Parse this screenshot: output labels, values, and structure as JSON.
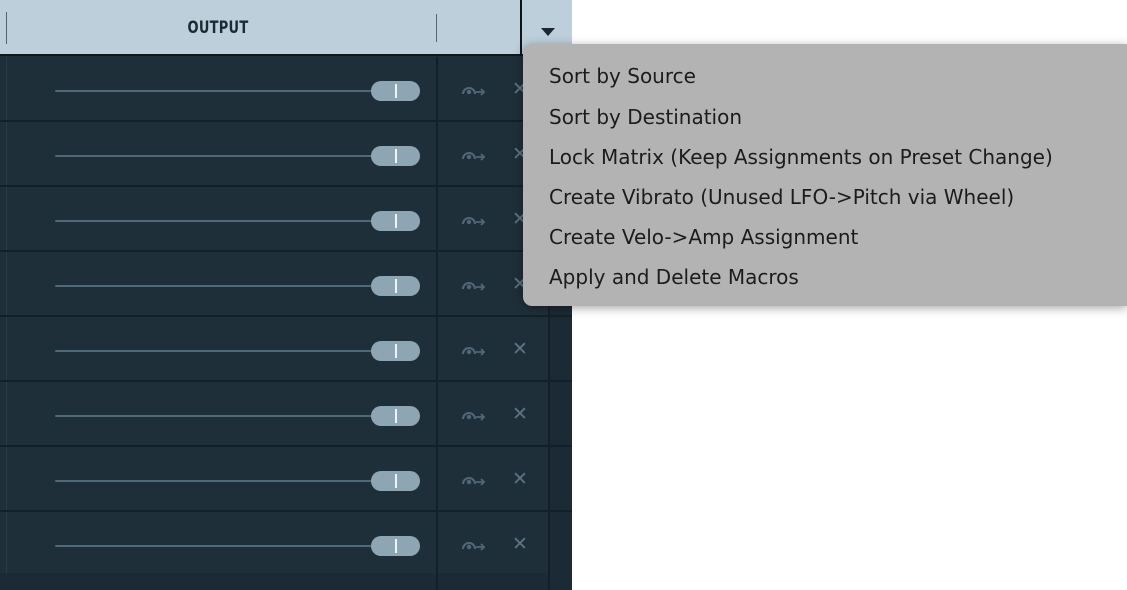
{
  "header": {
    "title": "OUTPUT",
    "dropdown_icon": "triangle-down-icon"
  },
  "rows": [
    {
      "via_icon": "modulation-via-icon",
      "delete_icon": "delete-x-icon",
      "delete_label": "✕"
    },
    {
      "via_icon": "modulation-via-icon",
      "delete_icon": "delete-x-icon",
      "delete_label": "✕"
    },
    {
      "via_icon": "modulation-via-icon",
      "delete_icon": "delete-x-icon",
      "delete_label": "✕"
    },
    {
      "via_icon": "modulation-via-icon",
      "delete_icon": "delete-x-icon",
      "delete_label": "✕"
    },
    {
      "via_icon": "modulation-via-icon",
      "delete_icon": "delete-x-icon",
      "delete_label": "✕"
    },
    {
      "via_icon": "modulation-via-icon",
      "delete_icon": "delete-x-icon",
      "delete_label": "✕"
    },
    {
      "via_icon": "modulation-via-icon",
      "delete_icon": "delete-x-icon",
      "delete_label": "✕"
    },
    {
      "via_icon": "modulation-via-icon",
      "delete_icon": "delete-x-icon",
      "delete_label": "✕"
    }
  ],
  "menu": {
    "items": [
      "Sort by Source",
      "Sort by Destination",
      "Lock Matrix (Keep Assignments on Preset Change)",
      "Create Vibrato (Unused LFO->Pitch via Wheel)",
      "Create Velo->Amp Assignment",
      "Apply and Delete Macros"
    ]
  },
  "colors": {
    "panel_bg": "#1f2f3a",
    "header_bg": "#bccfdb",
    "knob": "#8ea6b3",
    "menu_bg": "#b3b3b3"
  }
}
